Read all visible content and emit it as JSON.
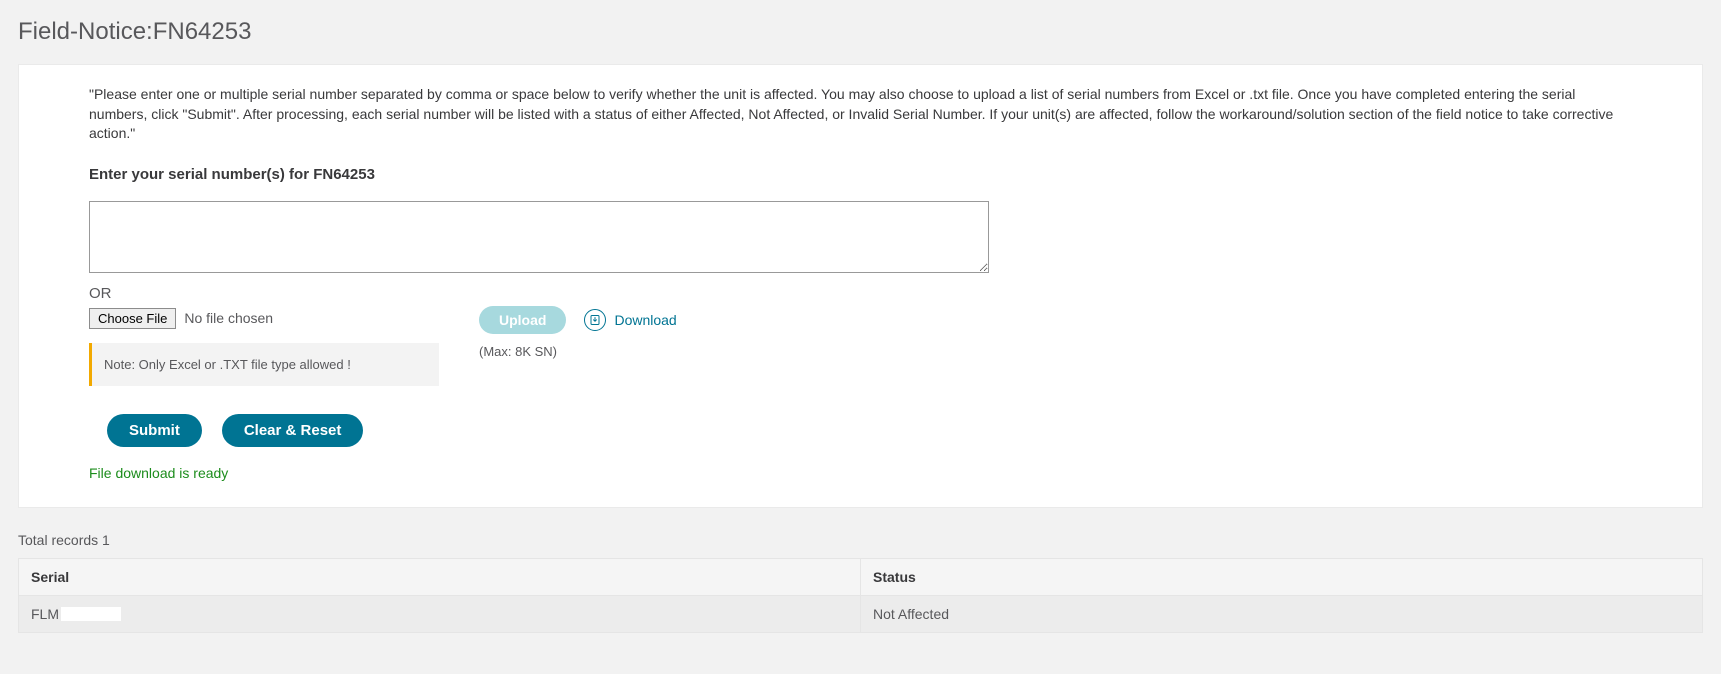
{
  "page": {
    "title": "Field-Notice:FN64253"
  },
  "form": {
    "instructions": "\"Please enter one or multiple serial number separated by comma or space below to verify whether the unit is affected. You may also choose to upload a list of serial numbers from Excel or .txt file. Once you have completed entering the serial numbers, click \"Submit\". After processing, each serial number will be listed with a status of either Affected, Not Affected, or Invalid Serial Number. If your unit(s) are affected, follow the workaround/solution section of the field notice to take corrective action.\"",
    "serial_label": "Enter your serial number(s) for FN64253",
    "textarea_value": "",
    "or_text": "OR",
    "choose_file_label": "Choose File",
    "no_file_text": "No file chosen",
    "note_text": "Note: Only Excel or .TXT file type allowed !",
    "upload_label": "Upload",
    "download_label": "Download",
    "max_note": "(Max: 8K SN)",
    "submit_label": "Submit",
    "clear_reset_label": "Clear & Reset",
    "download_ready": "File download is ready"
  },
  "results": {
    "total_label": "Total records 1",
    "columns": {
      "serial": "Serial",
      "status": "Status"
    },
    "rows": [
      {
        "serial_prefix": "FLM",
        "status": "Not Affected"
      }
    ]
  }
}
